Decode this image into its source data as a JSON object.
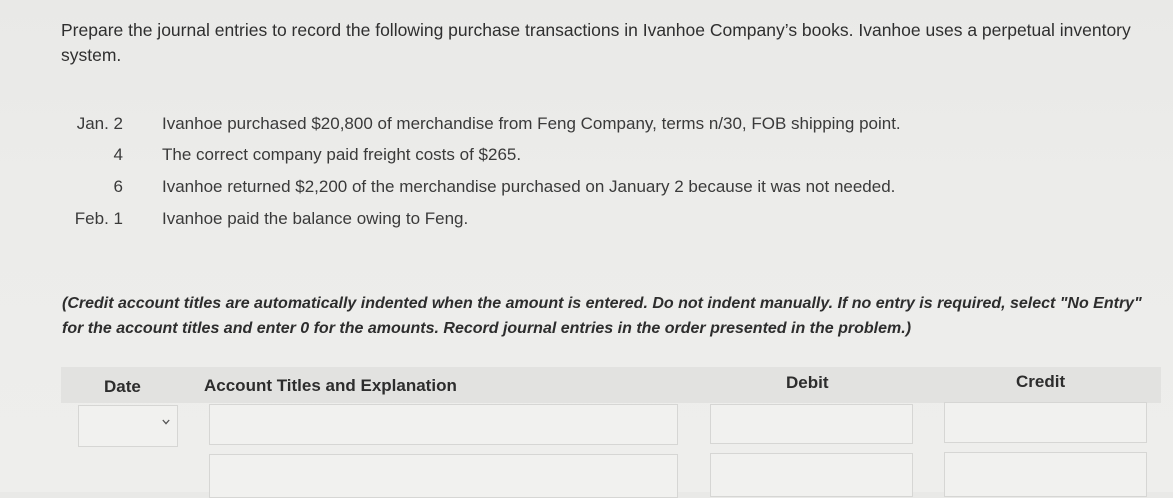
{
  "question": {
    "text": "Prepare the journal entries to record the following purchase transactions in Ivanhoe Company’s books. Ivanhoe uses a perpetual inventory system."
  },
  "transactions": [
    {
      "date": "Jan. 2",
      "description": "Ivanhoe purchased $20,800 of merchandise from Feng Company, terms n/30, FOB shipping point."
    },
    {
      "date": "4",
      "description": "The correct company paid freight costs of $265."
    },
    {
      "date": "6",
      "description": "Ivanhoe returned $2,200 of the merchandise purchased on January 2 because it was not needed."
    },
    {
      "date": "Feb. 1",
      "description": "Ivanhoe paid the balance owing to Feng."
    }
  ],
  "instructions": "(Credit account titles are automatically indented when the amount is entered. Do not indent manually. If no entry is required, select \"No Entry\" for the account titles and enter 0 for the amounts. Record journal entries in the order presented in the problem.)",
  "journal": {
    "headers": {
      "date": "Date",
      "account": "Account Titles and Explanation",
      "debit": "Debit",
      "credit": "Credit"
    },
    "row1": {
      "date_value": "",
      "account_value": "",
      "debit_value": "",
      "credit_value": ""
    },
    "row2": {
      "account_value": "",
      "debit_value": "",
      "credit_value": ""
    }
  },
  "icons": {
    "date_dropdown": "chevron-down-icon"
  }
}
